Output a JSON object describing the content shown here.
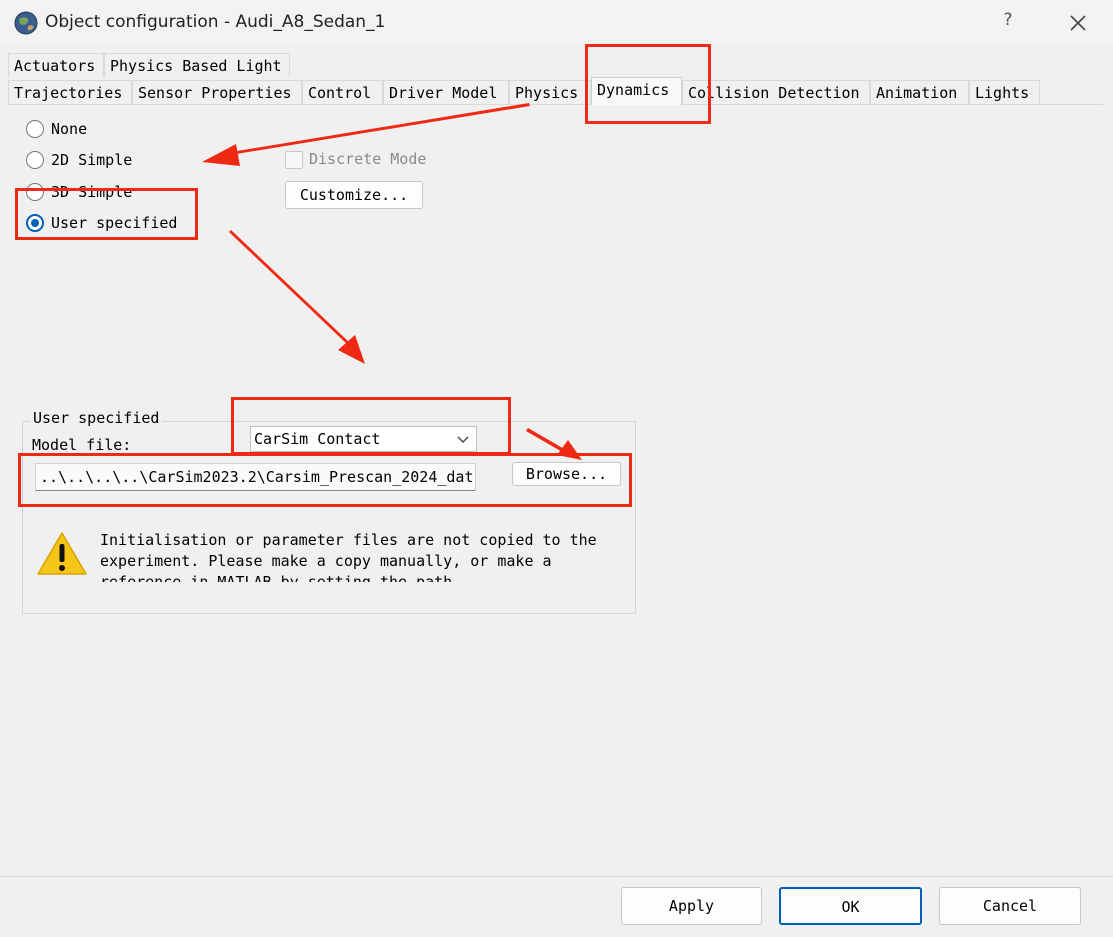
{
  "window": {
    "title": "Object configuration - Audi_A8_Sedan_1",
    "help_label": "?"
  },
  "tabs": {
    "row1": [
      "Actuators",
      "Physics Based Light"
    ],
    "row2": [
      "Trajectories",
      "Sensor Properties",
      "Control",
      "Driver Model",
      "Physics",
      "Dynamics",
      "Collision Detection",
      "Animation",
      "Lights"
    ],
    "active": "Dynamics"
  },
  "dynamics": {
    "options": [
      "None",
      "2D Simple",
      "3D Simple",
      "User specified"
    ],
    "selected": "User specified",
    "discrete_mode_label": "Discrete Mode",
    "customize_label": "Customize..."
  },
  "user_specified": {
    "group_title": "User specified",
    "model_file_label": "Model file:",
    "model_selected": "CarSim Contact",
    "path_value": "..\\..\\..\\..\\CarSim2023.2\\Carsim_Prescan_2024_dat",
    "browse_label": "Browse...",
    "warning_text": "Initialisation or parameter files are not copied to the experiment. Please make a copy manually, or make a reference in MATLAB by setting the path"
  },
  "footer": {
    "apply_label": "Apply",
    "ok_label": "OK",
    "cancel_label": "Cancel"
  },
  "colors": {
    "annotation_red": "#ee2a14",
    "accent_blue": "#005fb8"
  }
}
